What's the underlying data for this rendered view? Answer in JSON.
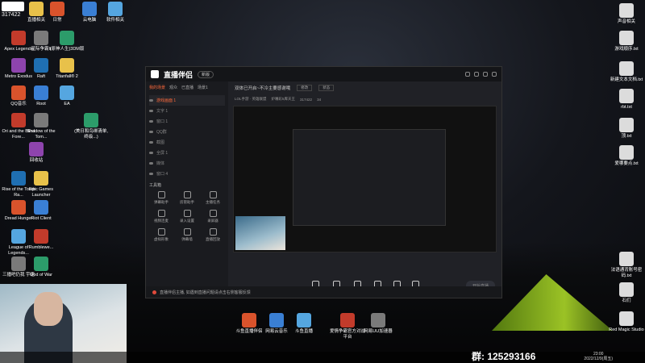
{
  "desktop": {
    "badge_number": "317422",
    "icons_left": [
      {
        "label": "直播相关"
      },
      {
        "label": "日常"
      },
      {
        "label": "云电脑"
      },
      {
        "label": "软件相关"
      },
      {
        "label": "Apex Legends"
      },
      {
        "label": "星际争霸II"
      },
      {
        "label": "(原神人生)3DM版"
      },
      {
        "label": "Metro Exodus"
      },
      {
        "label": "Raft"
      },
      {
        "label": "Titanfall® 2"
      },
      {
        "label": "QQ音乐"
      },
      {
        "label": "Root"
      },
      {
        "label": "EA"
      },
      {
        "label": "Ori and the Blind Fore..."
      },
      {
        "label": "Shadow of the Tom..."
      },
      {
        "label": "(美日和鸟绑清单, 终级...)"
      },
      {
        "label": "回收站"
      },
      {
        "label": "Rise of the Tomb Ra..."
      },
      {
        "label": "Epic Games Launcher"
      },
      {
        "label": "Dread Hunger"
      },
      {
        "label": "Riot Client"
      },
      {
        "label": "League of Legends..."
      },
      {
        "label": "Rumblewe..."
      },
      {
        "label": "三播吧仍我 宇语"
      },
      {
        "label": "God of War"
      }
    ],
    "icons_right": [
      {
        "label": "声音相关"
      },
      {
        "label": "游戏顺序.txt"
      },
      {
        "label": "新建文本文档.txt"
      },
      {
        "label": "rbt.txt"
      },
      {
        "label": "顶.txt"
      },
      {
        "label": "爱哪要点.txt"
      },
      {
        "label": "法语通背账号密码.txt"
      },
      {
        "label": "石们"
      },
      {
        "label": "Red Magic Studio"
      }
    ],
    "icons_bottom": [
      {
        "label": "斗鱼直播伴侣"
      },
      {
        "label": "网易云音乐"
      },
      {
        "label": "斗鱼直播"
      },
      {
        "label": "爱情争霸官方对战平台"
      },
      {
        "label": "网易UU加速器"
      }
    ],
    "qun_text": "群: 125293166",
    "clock_time": "23:00",
    "clock_date": "2022/12/9(周五)"
  },
  "app": {
    "name": "直播伴侣",
    "version_badge": "新版",
    "side_tabs": [
      "我的场景",
      "观众",
      "已直播",
      "场景1"
    ],
    "scenes": [
      {
        "label": "游戏画面 1",
        "active": true
      },
      {
        "label": "文字 1"
      },
      {
        "label": "窗口 1"
      },
      {
        "label": "QQ群"
      },
      {
        "label": "截图"
      },
      {
        "label": "全屏 1"
      },
      {
        "label": "媒体"
      },
      {
        "label": "窗口 4"
      }
    ],
    "tools_title": "工具箱",
    "tools": [
      {
        "label": "弹幕助手"
      },
      {
        "label": "房管助手"
      },
      {
        "label": "主播任务"
      },
      {
        "label": "视频连麦"
      },
      {
        "label": "录入设置"
      },
      {
        "label": "录屏器"
      },
      {
        "label": "虚拟形象"
      },
      {
        "label": "弹幕墙"
      },
      {
        "label": "直播回放"
      }
    ],
    "stream_title": "双体已开启~不冷主要感谢哦",
    "title_chip": "修改",
    "status_chip": "状态",
    "category": "LOL手游 · 英雄联盟",
    "room_name": "炉嘴彩5库天王",
    "room_id": "317422",
    "viewers": "34",
    "controls": [
      {
        "label": "直播画面"
      },
      {
        "label": "摄像头"
      },
      {
        "label": "多机位播"
      },
      {
        "label": "多媒体"
      },
      {
        "label": "麦克风"
      },
      {
        "label": "扬声器"
      }
    ],
    "stats": "码率: 0kbps  FPS: 0  CPU: 14%  内存: 0.5%",
    "start_button": "开始直播",
    "status_message": "直播伴侣主播, 如遇到直播问题请点击右侧客服反馈"
  }
}
